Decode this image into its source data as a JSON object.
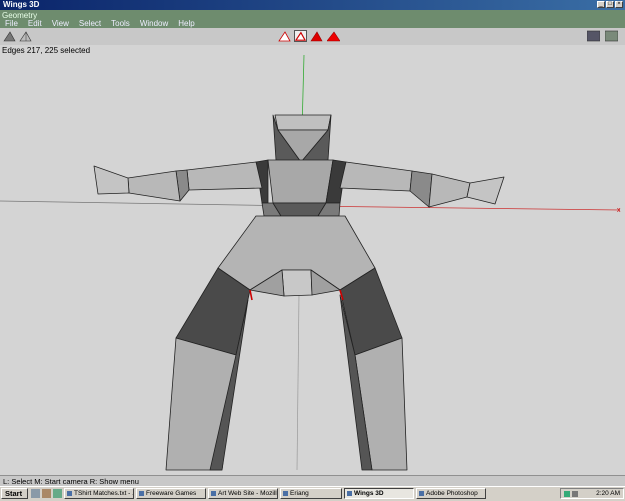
{
  "window": {
    "title": "Wings 3D",
    "controls": [
      "_",
      "□",
      "×"
    ]
  },
  "geometry_tab": "Geometry",
  "menu": [
    "File",
    "Edit",
    "View",
    "Select",
    "Tools",
    "Window",
    "Help"
  ],
  "viewport": {
    "info": "Edges 217, 225 selected",
    "axis_end_marker": "x"
  },
  "status": "L: Select   M: Start camera   R: Show menu",
  "taskbar": {
    "start": "Start",
    "tasks": [
      "TShirt Matches.txt - ...",
      "Freeware Games",
      "Art Web Site - Mozilla",
      "Eriang",
      "Wings 3D",
      "Adobe Photoshop"
    ],
    "active_task": "Wings 3D",
    "clock": "2:20 AM"
  },
  "colors": {
    "accent": "#0a246a",
    "selection_red": "#cc0000",
    "viewport": "#d4d4d4"
  }
}
